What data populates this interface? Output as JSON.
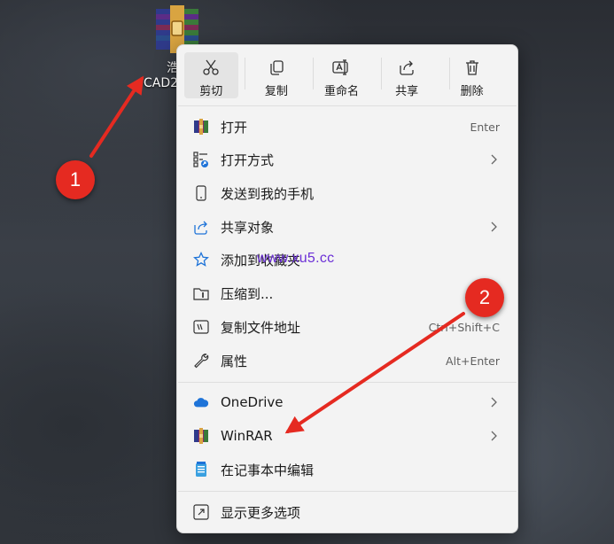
{
  "desktop_icon": {
    "label_line1": "浩",
    "label_line2": "CAD2"
  },
  "quick_actions": [
    {
      "label": "剪切",
      "icon": "scissors-icon"
    },
    {
      "label": "复制",
      "icon": "copy-icon"
    },
    {
      "label": "重命名",
      "icon": "rename-icon"
    },
    {
      "label": "共享",
      "icon": "share-icon"
    },
    {
      "label": "删除",
      "icon": "trash-icon"
    }
  ],
  "menu_items": [
    {
      "label": "打开",
      "shortcut": "Enter",
      "icon": "winrar-icon"
    },
    {
      "label": "打开方式",
      "icon": "open-with-icon",
      "submenu": true
    },
    {
      "label": "发送到我的手机",
      "icon": "phone-icon"
    },
    {
      "label": "共享对象",
      "icon": "share-icon",
      "submenu": true
    },
    {
      "label": "添加到收藏夹",
      "icon": "star-icon"
    },
    {
      "label": "压缩到...",
      "icon": "zip-icon"
    },
    {
      "label": "复制文件地址",
      "shortcut": "Ctrl+Shift+C",
      "icon": "copy-path-icon"
    },
    {
      "label": "属性",
      "shortcut": "Alt+Enter",
      "icon": "wrench-icon"
    },
    {
      "label": "OneDrive",
      "icon": "onedrive-icon",
      "submenu": true
    },
    {
      "label": "WinRAR",
      "icon": "winrar-icon",
      "submenu": true
    },
    {
      "label": "在记事本中编辑",
      "icon": "notepad-icon"
    },
    {
      "label": "显示更多选项",
      "icon": "more-options-icon"
    }
  ],
  "watermark": "www.xu5.cc",
  "badges": [
    "1",
    "2"
  ],
  "colors": {
    "accent": "#e52a21",
    "watermark": "#6b2fd6",
    "menu_bg": "#f3f3f3"
  }
}
